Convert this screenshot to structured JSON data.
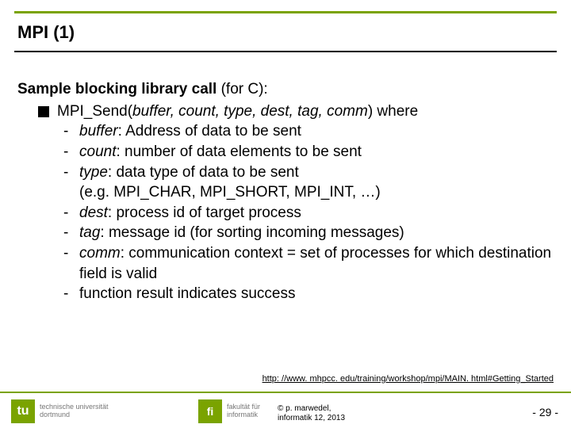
{
  "slide": {
    "title": "MPI (1)",
    "intro_prefix": "Sample blocking library call",
    "intro_suffix": " (for C):",
    "bullet_prefix": "MPI_Send(",
    "bullet_args": "buffer, count, type, dest, tag, comm",
    "bullet_suffix": ") where",
    "items": [
      {
        "term": "buffer",
        "desc": ": Address of data to be sent"
      },
      {
        "term": "count",
        "desc": ": number of data elements to be sent"
      },
      {
        "term": "type",
        "desc": ": data type of data to be sent",
        "desc2_plain": "(e.g. MPI_CHAR, MPI_SHORT, MPI_INT, …)"
      },
      {
        "term": "dest",
        "desc": ": process id of target process"
      },
      {
        "term": "tag",
        "desc": ": message id (for sorting incoming messages)"
      },
      {
        "term": "comm",
        "desc": ": communication context = set of processes for which destination field is valid"
      },
      {
        "plain": "function result indicates success"
      }
    ],
    "source_link": "http: //www. mhpcc. edu/training/workshop/mpi/MAIN. html#Getting_Started",
    "footer": {
      "tu_mark": "tu",
      "tu_line1": "technische universität",
      "tu_line2": "dortmund",
      "fi_mark": "fi",
      "fi_line1": "fakultät für",
      "fi_line2": "informatik",
      "copy_line1": "©  p. marwedel,",
      "copy_line2": "informatik 12,  2013",
      "page_prefix": "-  ",
      "page_num": "29",
      "page_suffix": " -"
    }
  }
}
